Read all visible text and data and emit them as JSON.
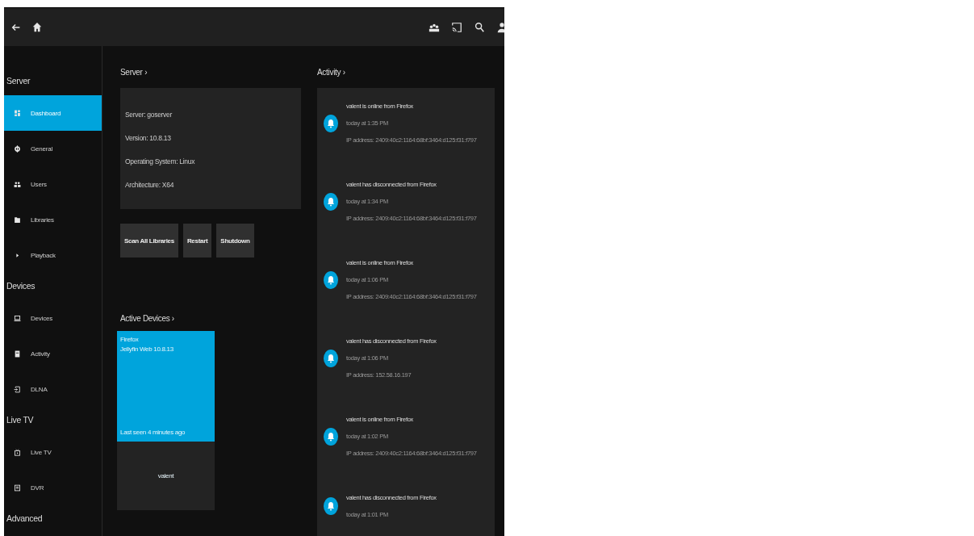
{
  "sidebar": {
    "sections": [
      {
        "title": "Server",
        "items": [
          {
            "label": "Dashboard",
            "selected": true
          },
          {
            "label": "General",
            "selected": false
          },
          {
            "label": "Users",
            "selected": false
          },
          {
            "label": "Libraries",
            "selected": false
          },
          {
            "label": "Playback",
            "selected": false
          }
        ]
      },
      {
        "title": "Devices",
        "items": [
          {
            "label": "Devices",
            "selected": false
          },
          {
            "label": "Activity",
            "selected": false
          },
          {
            "label": "DLNA",
            "selected": false
          }
        ]
      },
      {
        "title": "Live TV",
        "items": [
          {
            "label": "Live TV",
            "selected": false
          },
          {
            "label": "DVR",
            "selected": false
          }
        ]
      },
      {
        "title": "Advanced"
      }
    ]
  },
  "server": {
    "heading": "Server ›",
    "lines": [
      "Server: goserver",
      "Version: 10.8.13",
      "Operating System: Linux",
      "Architecture: X64"
    ],
    "buttons": [
      "Scan All Libraries",
      "Restart",
      "Shutdown"
    ]
  },
  "active_devices": {
    "heading": "Active Devices ›",
    "devices": [
      {
        "client": "Firefox",
        "app": "Jellyfin Web 10.8.13",
        "last_seen": "Last seen 4 minutes ago",
        "user": "valent"
      }
    ]
  },
  "activity": {
    "heading": "Activity ›",
    "entries": [
      {
        "title": "valent is online from Firefox",
        "time": "today at 1:35 PM",
        "detail": "IP address: 2409:40c2:1164:68bf:3464:d125:f31:f797"
      },
      {
        "title": "valent has disconnected from Firefox",
        "time": "today at 1:34 PM",
        "detail": "IP address: 2409:40c2:1164:68bf:3464:d125:f31:f797"
      },
      {
        "title": "valent is online from Firefox",
        "time": "today at 1:06 PM",
        "detail": "IP address: 2409:40c2:1164:68bf:3464:d125:f31:f797"
      },
      {
        "title": "valent has disconnected from Firefox",
        "time": "today at 1:06 PM",
        "detail": "IP address: 152.58.16.197"
      },
      {
        "title": "valent is online from Firefox",
        "time": "today at 1:02 PM",
        "detail": "IP address: 2409:40c2:1164:68bf:3464:d125:f31:f797"
      },
      {
        "title": "valent has disconnected from Firefox",
        "time": "today at 1:01 PM"
      }
    ]
  }
}
